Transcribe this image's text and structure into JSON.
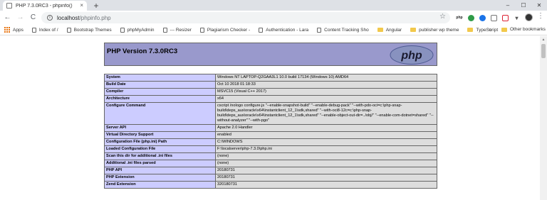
{
  "browser": {
    "tab": {
      "title": "PHP 7.3.0RC3 - phpinfo()",
      "close": "×"
    },
    "new_tab": "+",
    "window_controls": [
      "–",
      "☐",
      "✕"
    ],
    "nav": {
      "back": "←",
      "forward": "→",
      "reload": "C",
      "home": "⌂"
    },
    "address": {
      "host": "localhost",
      "path": "/phpinfo.php"
    },
    "star": "☆",
    "extensions": [
      "php",
      "",
      "",
      "",
      "",
      "▾"
    ],
    "menu": "⋮"
  },
  "bookmarks": {
    "items": [
      {
        "label": "Apps",
        "icon": "apps-grid-icon"
      },
      {
        "label": "Index of /",
        "icon": "page-icon"
      },
      {
        "label": "Bootstrap Themes",
        "icon": "page-icon"
      },
      {
        "label": "phpMyAdmin",
        "icon": "page-icon"
      },
      {
        "label": "--- Resizer",
        "icon": "page-icon"
      },
      {
        "label": "Plagiarism Checker -",
        "icon": "page-icon"
      },
      {
        "label": "Authentication - Lara",
        "icon": "page-icon"
      },
      {
        "label": "Content Tracking Sho",
        "icon": "page-icon"
      },
      {
        "label": "Angular",
        "icon": "folder-icon"
      },
      {
        "label": "publisher wp theme",
        "icon": "folder-icon"
      },
      {
        "label": "TypeScript",
        "icon": "folder-icon"
      }
    ],
    "overflow": "»",
    "other": "Other bookmarks"
  },
  "page": {
    "header_title": "PHP Version 7.3.0RC3",
    "logo_text": "php",
    "rows": [
      {
        "key": "System",
        "value": "Windows NT LAPTOP-Q2GAA3L1 10.0 build 17134 (Windows 10) AMD64"
      },
      {
        "key": "Build Date",
        "value": "Oct 10 2018 01:18:33"
      },
      {
        "key": "Compiler",
        "value": "MSVC15 (Visual C++ 2017)"
      },
      {
        "key": "Architecture",
        "value": "x64"
      },
      {
        "key": "Configure Command",
        "value": "cscript /nologo configure.js \"--enable-snapshot-build\" \"--enable-debug-pack\" \"--with-pdo-oci=c:\\php-snap-build\\deps_aux\\oracle\\x64\\instantclient_12_1\\sdk,shared\" \"--with-oci8-12c=c:\\php-snap-build\\deps_aux\\oracle\\x64\\instantclient_12_1\\sdk,shared\" \"--enable-object-out-dir=../obj/\" \"--enable-com-dotnet=shared\" \"--without-analyzer\" \"--with-pgo\""
      },
      {
        "key": "Server API",
        "value": "Apache 2.0 Handler"
      },
      {
        "key": "Virtual Directory Support",
        "value": "enabled"
      },
      {
        "key": "Configuration File (php.ini) Path",
        "value": "C:\\WINDOWS"
      },
      {
        "key": "Loaded Configuration File",
        "value": "F:\\localserver\\php-7.3.0\\php.ini"
      },
      {
        "key": "Scan this dir for additional .ini files",
        "value": "(none)"
      },
      {
        "key": "Additional .ini files parsed",
        "value": "(none)"
      },
      {
        "key": "PHP API",
        "value": "20180731"
      },
      {
        "key": "PHP Extension",
        "value": "20180731"
      },
      {
        "key": "Zend Extension",
        "value": "320180731"
      }
    ]
  },
  "colors": {
    "header_bg": "#9999cc",
    "key_cell_bg": "#ccccff",
    "value_cell_bg": "#dddddd",
    "logo_bg": "#8892bf"
  }
}
